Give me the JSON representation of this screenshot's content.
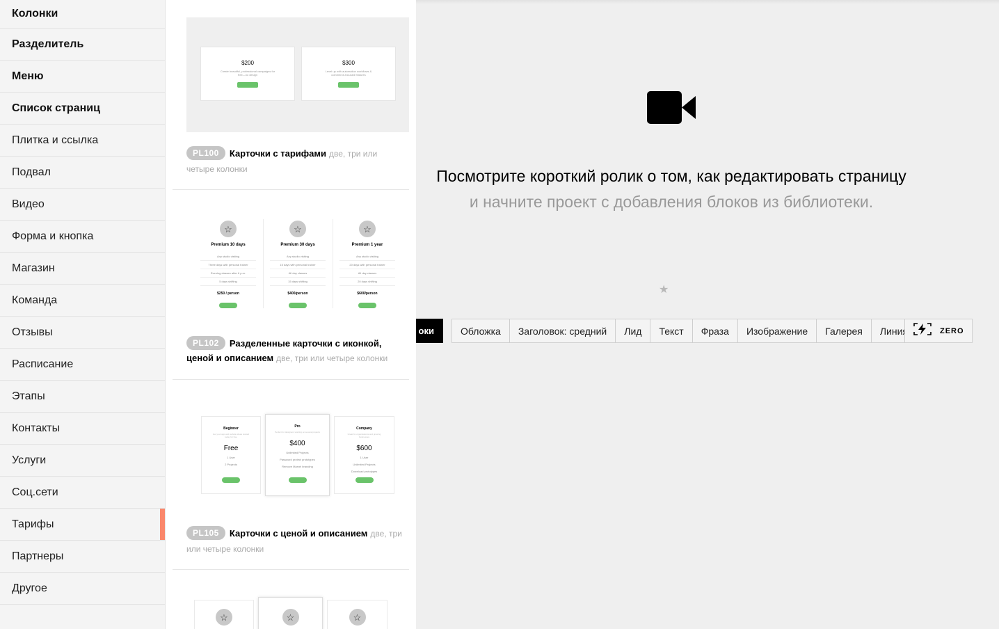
{
  "sidebar": {
    "items": [
      {
        "label": "Колонки"
      },
      {
        "label": "Разделитель"
      },
      {
        "label": "Меню"
      },
      {
        "label": "Список страниц"
      },
      {
        "label": "Плитка и ссылка"
      },
      {
        "label": "Подвал"
      },
      {
        "label": "Видео"
      },
      {
        "label": "Форма и кнопка"
      },
      {
        "label": "Магазин"
      },
      {
        "label": "Команда"
      },
      {
        "label": "Отзывы"
      },
      {
        "label": "Расписание"
      },
      {
        "label": "Этапы"
      },
      {
        "label": "Контакты"
      },
      {
        "label": "Услуги"
      },
      {
        "label": "Соц.сети"
      },
      {
        "label": "Тарифы"
      },
      {
        "label": "Партнеры"
      },
      {
        "label": "Другое"
      }
    ],
    "active_item": "Тарифы",
    "active_color": "#fa876b"
  },
  "library": {
    "blocks": [
      {
        "code": "PL100",
        "title": "Карточки с тарифами",
        "note": "две, три или четыре колонки",
        "preview": {
          "cards": [
            {
              "price": "$200",
              "text": "Create beautiful, professional campaigns for free—no design"
            },
            {
              "price": "$300",
              "text": "Level up with automation workflows & commerce-focused features"
            }
          ]
        }
      },
      {
        "code": "PL102",
        "title": "Разделенные карточки с иконкой, ценой и описанием",
        "note": "две, три или четыре колонки",
        "preview": {
          "columns": [
            {
              "title": "Premium 10 days",
              "lines": [
                "Any studio visiting",
                "Three days with personal trainer",
                "Evening classes after 6 p.m.",
                "5 days shifting"
              ],
              "price": "$250 / person"
            },
            {
              "title": "Premium 30 days",
              "lines": [
                "Any studio visiting",
                "15 days with personal trainer",
                "All day classes",
                "15 days shifting"
              ],
              "price": "$400/person"
            },
            {
              "title": "Premium 1 year",
              "lines": [
                "Any studio visiting",
                "20 days with personal trainer",
                "All day classes",
                "20 days shifting"
              ],
              "price": "$600/person"
            }
          ]
        }
      },
      {
        "code": "PL105",
        "title": "Карточки с ценой и описанием",
        "note": "две, три или четыре колонки",
        "preview": {
          "cards": [
            {
              "name": "Beginner",
              "sub": "Get your app and website ideas started today for free",
              "price": "Free",
              "lines": [
                "1 User",
                "2 Projects"
              ]
            },
            {
              "name": "Pro",
              "sub": "Perfect for designers working on several projects",
              "price": "$400",
              "lines": [
                "Unlimited Projects",
                "Password protect prototypes",
                "Remove Marvel branding"
              ]
            },
            {
              "name": "Company",
              "sub": "Great for organisations and growing businesses",
              "price": "$600",
              "lines": [
                "1 User",
                "Unlimited Projects",
                "Download prototypes"
              ]
            }
          ]
        }
      }
    ]
  },
  "main": {
    "headline": "Посмотрите короткий ролик о том, как редактировать страницу",
    "subline": "и начните проект с добавления блоков из библиотеки.",
    "all_blocks_label": "оки",
    "quick_buttons": [
      "Обложка",
      "Заголовок: средний",
      "Лид",
      "Текст",
      "Фраза",
      "Изображение",
      "Галерея",
      "Линия"
    ],
    "zero_label": "ZERO"
  },
  "colors": {
    "accent": "#fa876b",
    "button_green": "#6ac36a",
    "badge_gray": "#c5c5c5"
  }
}
